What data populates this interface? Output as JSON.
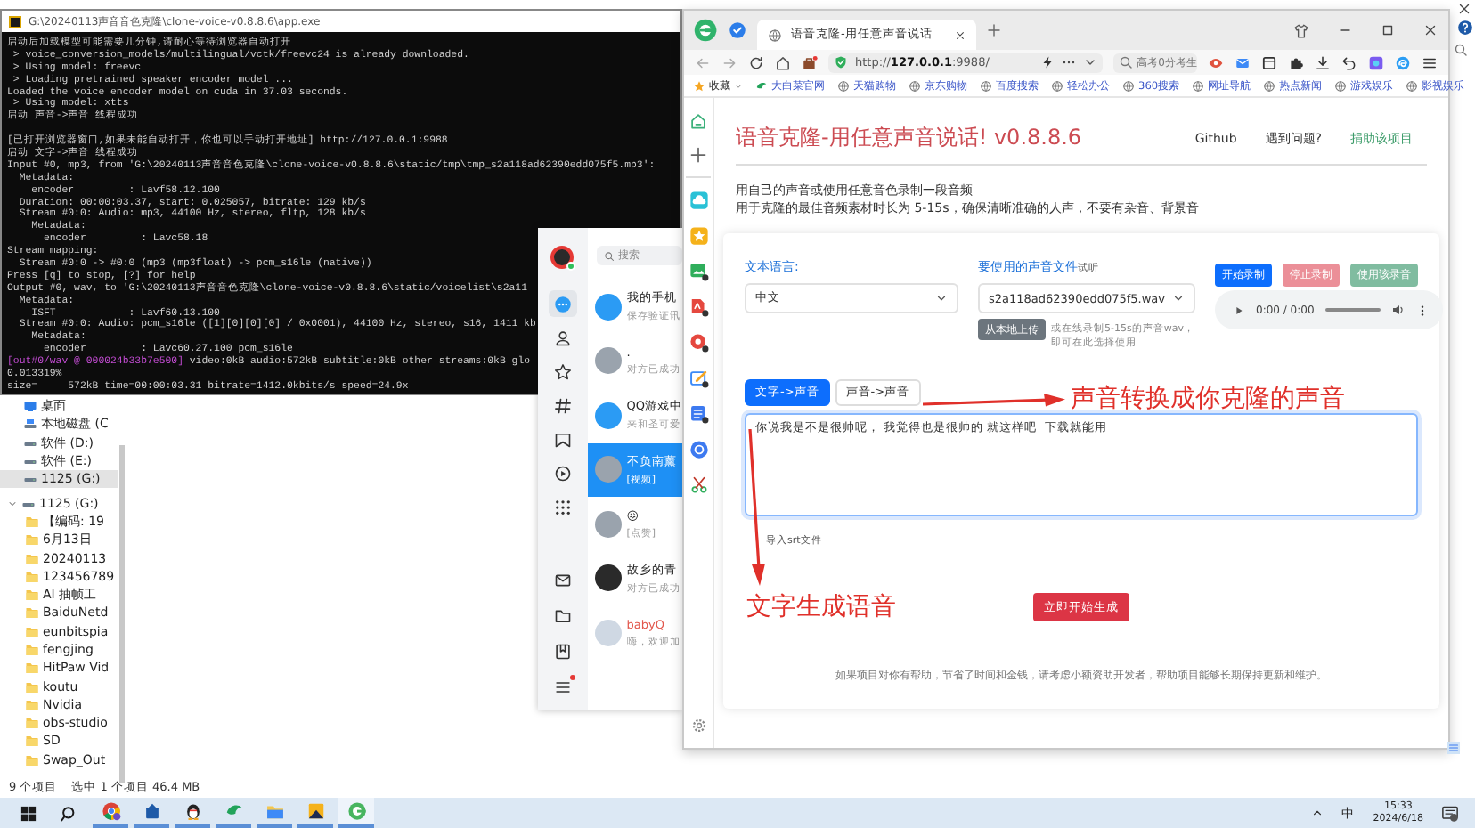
{
  "console": {
    "title": "G:\\20240113声音音色克隆\\clone-voice-v0.8.8.6\\app.exe",
    "lines": [
      {
        "kind": "text",
        "text": "启动后加载模型可能需要几分钟,请耐心等待浏览器自动打开"
      },
      {
        "kind": "text",
        "text": " > voice_conversion_models/multilingual/vctk/freevc24 is already downloaded."
      },
      {
        "kind": "text",
        "text": " > Using model: freevc"
      },
      {
        "kind": "text",
        "text": " > Loading pretrained speaker encoder model ..."
      },
      {
        "kind": "text",
        "text": "Loaded the voice encoder model on cuda in 37.03 seconds."
      },
      {
        "kind": "text",
        "text": " > Using model: xtts"
      },
      {
        "kind": "text",
        "text": "启动 声音->声音 线程成功"
      },
      {
        "kind": "blank"
      },
      {
        "kind": "text",
        "text": "[已打开浏览器窗口,如果未能自动打开，你也可以手动打开地址] http://127.0.0.1:9988"
      },
      {
        "kind": "text",
        "text": "启动 文字->声音 线程成功"
      },
      {
        "kind": "text",
        "text": "Input #0, mp3, from 'G:\\20240113声音音色克隆\\clone-voice-v0.8.8.6\\static/tmp\\tmp_s2a118ad62390edd075f5.mp3':"
      },
      {
        "kind": "text",
        "text": "  Metadata:"
      },
      {
        "kind": "text",
        "text": "    encoder         : Lavf58.12.100"
      },
      {
        "kind": "text",
        "text": "  Duration: 00:00:03.37, start: 0.025057, bitrate: 129 kb/s"
      },
      {
        "kind": "text",
        "text": "  Stream #0:0: Audio: mp3, 44100 Hz, stereo, fltp, 128 kb/s"
      },
      {
        "kind": "text",
        "text": "    Metadata:"
      },
      {
        "kind": "text",
        "text": "      encoder         : Lavc58.18"
      },
      {
        "kind": "text",
        "text": "Stream mapping:"
      },
      {
        "kind": "text",
        "text": "  Stream #0:0 -> #0:0 (mp3 (mp3float) -> pcm_s16le (native))"
      },
      {
        "kind": "text",
        "text": "Press [q] to stop, [?] for help"
      },
      {
        "kind": "text",
        "text": "Output #0, wav, to 'G:\\20240113声音音色克隆\\clone-voice-v0.8.8.6\\static/voicelist\\s2a11"
      },
      {
        "kind": "text",
        "text": "  Metadata:"
      },
      {
        "kind": "text",
        "text": "    ISFT            : Lavf60.13.100"
      },
      {
        "kind": "text",
        "text": "  Stream #0:0: Audio: pcm_s16le ([1][0][0][0] / 0x0001), 44100 Hz, stereo, s16, 1411 kb"
      },
      {
        "kind": "text",
        "text": "    Metadata:"
      },
      {
        "kind": "text",
        "text": "      encoder         : Lavc60.27.100 pcm_s16le"
      },
      {
        "kind": "log",
        "prefix": "[out#0/wav @ 000024b33b7e500]",
        "text": " video:0kB audio:572kB subtitle:0kB other streams:0kB glo"
      },
      {
        "kind": "text",
        "text": "0.013319%"
      },
      {
        "kind": "text",
        "text": "size=     572kB time=00:00:03.31 bitrate=1412.0kbits/s speed=24.9x"
      }
    ]
  },
  "explorer": {
    "nav": [
      {
        "label": "桌面",
        "kind": "desktop",
        "selected": false
      },
      {
        "label": "本地磁盘 (C",
        "kind": "system_drive",
        "selected": false
      },
      {
        "label": "软件 (D:)",
        "kind": "drive",
        "selected": false
      },
      {
        "label": "软件 (E:)",
        "kind": "drive",
        "selected": false
      },
      {
        "label": "1125 (G:)",
        "kind": "drive",
        "selected": true
      }
    ],
    "tree": {
      "label": "1125 (G:)",
      "expanded": true,
      "children": [
        {
          "label": "【编码: 19"
        },
        {
          "label": "6月13日"
        },
        {
          "label": "20240113"
        },
        {
          "label": "123456789"
        },
        {
          "label": "AI 抽帧工"
        },
        {
          "label": "BaiduNetd"
        },
        {
          "label": "eunbitspia"
        },
        {
          "label": "fengjing"
        },
        {
          "label": "HitPaw Vid"
        },
        {
          "label": "koutu"
        },
        {
          "label": "Nvidia"
        },
        {
          "label": "obs-studio"
        },
        {
          "label": "SD"
        },
        {
          "label": "Swap_Out"
        }
      ]
    },
    "status": [
      "9 个项目",
      "选中 1 个项目  46.4 MB"
    ]
  },
  "chat": {
    "search": {
      "placeholder": "搜索"
    },
    "nav": [
      {
        "kind": "chat",
        "selected": true,
        "notice": false
      },
      {
        "kind": "contacts",
        "selected": false,
        "notice": false
      },
      {
        "kind": "favorites",
        "selected": false,
        "notice": false
      },
      {
        "kind": "channels",
        "selected": false,
        "notice": false
      },
      {
        "kind": "frame",
        "selected": false,
        "notice": false
      },
      {
        "kind": "video",
        "selected": false,
        "notice": false
      },
      {
        "kind": "apps",
        "selected": false,
        "notice": false
      },
      {
        "kind": "mail",
        "selected": false,
        "notice": false
      },
      {
        "kind": "files",
        "selected": false,
        "notice": false
      },
      {
        "kind": "saved",
        "selected": false,
        "notice": false
      },
      {
        "kind": "menu",
        "selected": false,
        "notice": true
      }
    ],
    "conversations": [
      {
        "kind": "phone",
        "name": "我的手机",
        "preview": "保存验证讯",
        "selected": false
      },
      {
        "kind": "person",
        "name": ".",
        "preview": "对方已成功",
        "selected": false
      },
      {
        "kind": "game",
        "name": "QQ游戏中",
        "preview": "来和圣可爱",
        "selected": false
      },
      {
        "kind": "person",
        "name": "不负南薰",
        "preview": "[视频]",
        "selected": true
      },
      {
        "kind": "person",
        "name": "😖",
        "preview": "[点赞]",
        "selected": false
      },
      {
        "kind": "silhouette",
        "name": "故乡的青",
        "preview": "对方已成功",
        "selected": false
      },
      {
        "kind": "bot",
        "name": "babyQ",
        "preview": "嗨，欢迎加",
        "selected": false
      }
    ]
  },
  "browser": {
    "tabs": [
      {
        "title": "语音克隆-用任意声音说话",
        "selected": true
      }
    ],
    "url": "http://**127.0.0.1**:9988/",
    "search": {
      "placeholder": "高考0分考生"
    },
    "bookmarks": [
      {
        "label": "收藏",
        "kind": "favorites"
      },
      {
        "label": "大白菜官网",
        "kind": "site"
      },
      {
        "label": "天猫购物",
        "kind": "link"
      },
      {
        "label": "京东购物",
        "kind": "link"
      },
      {
        "label": "百度搜索",
        "kind": "link"
      },
      {
        "label": "轻松办公",
        "kind": "link"
      },
      {
        "label": "360搜索",
        "kind": "link"
      },
      {
        "label": "网址导航",
        "kind": "link"
      },
      {
        "label": "热点新闻",
        "kind": "link"
      },
      {
        "label": "游戏娱乐",
        "kind": "link"
      },
      {
        "label": "影视娱乐",
        "kind": "link"
      }
    ]
  },
  "app": {
    "title": "语音克隆-用任意声音说话! v0.8.8.6",
    "links": [
      {
        "label": "Github",
        "kind": "plain"
      },
      {
        "label": "遇到问题?",
        "kind": "plain"
      },
      {
        "label": "捐助该项目",
        "kind": "donate"
      }
    ],
    "intro": [
      "用自己的声音或使用任意音色录制一段音频",
      "用于克隆的最佳音频素材时长为 5-15s，确保清晰准确的人声，不要有杂音、背景音"
    ],
    "language": {
      "label": "文本语言:",
      "value": "中文"
    },
    "voice": {
      "label": "要使用的声音文件",
      "preview_link": "试听",
      "value": "s2a118ad62390edd075f5.wav",
      "upload_button": "从本地上传",
      "upload_note": "或在线录制5-15s的声音wav，即可在此选择使用"
    },
    "record_buttons": [
      {
        "label": "开始录制",
        "kind": "primary",
        "disabled": false
      },
      {
        "label": "停止录制",
        "kind": "danger",
        "disabled": true
      },
      {
        "label": "使用该录音",
        "kind": "success",
        "disabled": true
      }
    ],
    "player": {
      "time": "0:00 / 0:00"
    },
    "mode_tabs": [
      {
        "label": "文字->声音",
        "selected": true
      },
      {
        "label": "声音->声音",
        "selected": false
      }
    ],
    "text_input": {
      "value": "你说我是不是很帅呢， 我觉得也是很帅的 就这样吧  下载就能用"
    },
    "import_link": "导入srt文件",
    "generate_button": "立即开始生成",
    "footer": "如果项目对你有帮助，节省了时间和金钱，请考虑小额资助开发者，帮助项目能够长期保持更新和维护。"
  },
  "annotations": [
    {
      "text": "声音转换成你克隆的声音",
      "kind": "right"
    },
    {
      "text": "文字生成语音",
      "kind": "down"
    }
  ],
  "taskbar": {
    "apps": [
      {
        "kind": "chrome",
        "running": true,
        "focused": false
      },
      {
        "kind": "blue_app",
        "running": true,
        "focused": false
      },
      {
        "kind": "messenger",
        "running": true,
        "focused": false
      },
      {
        "kind": "green_app",
        "running": true,
        "focused": false
      },
      {
        "kind": "folder",
        "running": true,
        "focused": false
      },
      {
        "kind": "image_app",
        "running": true,
        "focused": false
      },
      {
        "kind": "browser",
        "running": true,
        "focused": true
      }
    ],
    "tray": {
      "ime": "中",
      "time": "15:33",
      "date": "2024/6/18"
    }
  }
}
